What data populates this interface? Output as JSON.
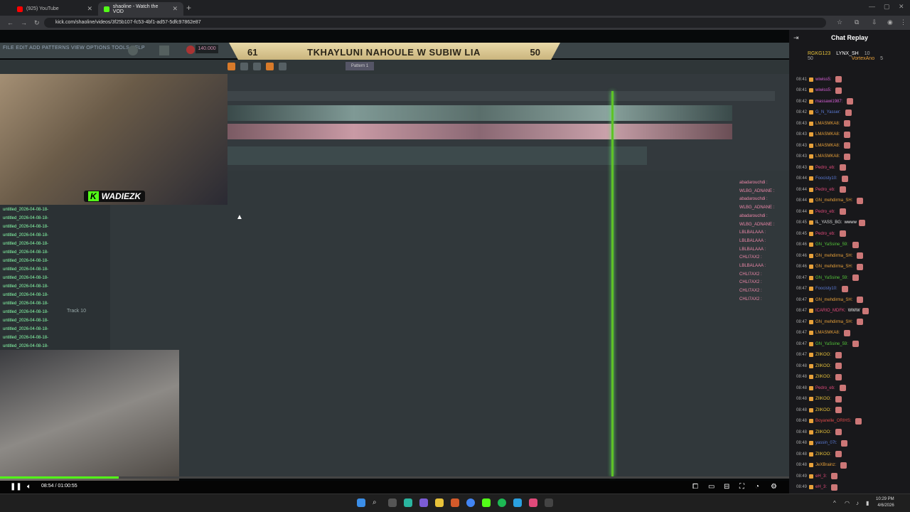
{
  "browser": {
    "tabs": [
      {
        "title": "(925) YouTube",
        "color": "#ff0000"
      },
      {
        "title": "shaoline - Watch the VOD",
        "color": "#53fc18"
      }
    ],
    "url": "kick.com/shaoline/videos/3f25b107-fc53-4bf1-ad57-5dfc97862e87"
  },
  "stream": {
    "menu": "FILE EDIT ADD PATTERNS VIEW OPTIONS TOOLS HELP",
    "tempo": "140.000",
    "pattern": "Pattern 1",
    "banner_left": "61",
    "banner_title": "TKHAYLUNI NAHOULE W SUBIW LIA",
    "banner_right": "50",
    "cam_label": "WADIEZK",
    "track_label": "Track 10",
    "track_clips": [
      "untitled_2026-04-08-18-",
      "untitled_2026-04-08-18-",
      "untitled_2026-04-08-18-",
      "untitled_2026-04-08-18-",
      "untitled_2026-04-08-18-",
      "untitled_2026-04-08-18-",
      "untitled_2026-04-08-18-",
      "untitled_2026-04-08-18-",
      "untitled_2026-04-08-18-",
      "untitled_2026-04-08-18-",
      "untitled_2026-04-08-18-",
      "untitled_2026-04-08-18-",
      "untitled_2026-04-08-18-",
      "untitled_2026-04-08-18-",
      "untitled_2026-04-08-18-",
      "untitled_2026-04-08-18-",
      "untitled_2026-04-08-18-"
    ],
    "overlay_chat": [
      "abadarouchdi :",
      "WLBG_ADNANE :",
      "abadarouchdi :",
      "WLBG_ADNANE :",
      "abadarouchdi :",
      "WLBG_ADNANE :",
      "LBLBALAAA :",
      "LBLBALAAA :",
      "LBLBALAAA :",
      "CHLI7AX2 :",
      "LBLBALAAA :",
      "CHLI7AX2 :",
      "CHLI7AX2 :",
      "CHLI7AX2 :",
      "CHLI7AX2 :"
    ]
  },
  "player": {
    "timecode": "08:54 / 01:00:55",
    "progress": 0.15
  },
  "chat": {
    "title": "Chat Replay",
    "pinned": [
      {
        "name": "RGKG123",
        "count": "50"
      },
      {
        "name": "LYNX_SH",
        "count": "10"
      },
      {
        "name": "VortexAno",
        "count": "5"
      }
    ],
    "messages": [
      {
        "time": "08:41",
        "user": "wiwiss5:",
        "color": "#d45fd4",
        "text": ""
      },
      {
        "time": "08:41",
        "user": "wiwiss5:",
        "color": "#d45fd4",
        "text": ""
      },
      {
        "time": "08:42",
        "user": "massawi1987:",
        "color": "#d45fd4",
        "text": ""
      },
      {
        "time": "08:42",
        "user": "G_N_Yasser:",
        "color": "#5b7bd6",
        "text": ""
      },
      {
        "time": "08:43",
        "user": "LMASMKA8:",
        "color": "#e8a13a",
        "text": ""
      },
      {
        "time": "08:43",
        "user": "LMASMKA8:",
        "color": "#e8a13a",
        "text": ""
      },
      {
        "time": "08:43",
        "user": "LMASMKA8:",
        "color": "#e8a13a",
        "text": ""
      },
      {
        "time": "08:43",
        "user": "LMASMKA8:",
        "color": "#e8a13a",
        "text": ""
      },
      {
        "time": "08:43",
        "user": "Pedro_eb:",
        "color": "#e04a7a",
        "text": ""
      },
      {
        "time": "08:44",
        "user": "Foocisty10:",
        "color": "#5b7bd6",
        "text": ""
      },
      {
        "time": "08:44",
        "user": "Pedro_eb:",
        "color": "#e04a7a",
        "text": ""
      },
      {
        "time": "08:44",
        "user": "GN_mehdirma_SH:",
        "color": "#e8a13a",
        "text": ""
      },
      {
        "time": "08:44",
        "user": "Pedro_eb:",
        "color": "#e04a7a",
        "text": ""
      },
      {
        "time": "08:45",
        "user": "IL_YASS_BG:",
        "color": "#dddddd",
        "text": "wwww"
      },
      {
        "time": "08:45",
        "user": "Pedro_eb:",
        "color": "#e04a7a",
        "text": ""
      },
      {
        "time": "08:46",
        "user": "GN_YaSsine_59:",
        "color": "#53c43a",
        "text": ""
      },
      {
        "time": "08:46",
        "user": "GN_mehdirma_SH:",
        "color": "#e8a13a",
        "text": ""
      },
      {
        "time": "08:46",
        "user": "GN_mehdirma_SH:",
        "color": "#e8a13a",
        "text": ""
      },
      {
        "time": "08:47",
        "user": "GN_YaSsine_59:",
        "color": "#53c43a",
        "text": ""
      },
      {
        "time": "08:47",
        "user": "Foocisty10:",
        "color": "#5b7bd6",
        "text": ""
      },
      {
        "time": "08:47",
        "user": "GN_mehdirma_SH:",
        "color": "#e8a13a",
        "text": ""
      },
      {
        "time": "08:47",
        "user": "ICARIO_MDFK:",
        "color": "#e04a7a",
        "text": "WWW"
      },
      {
        "time": "08:47",
        "user": "GN_mehdirma_SH:",
        "color": "#e8a13a",
        "text": ""
      },
      {
        "time": "08:47",
        "user": "LMASMKA8:",
        "color": "#e8a13a",
        "text": ""
      },
      {
        "time": "08:47",
        "user": "GN_YaSsine_59:",
        "color": "#53c43a",
        "text": ""
      },
      {
        "time": "08:47",
        "user": "ZIIKOO:",
        "color": "#e8c23a",
        "text": ""
      },
      {
        "time": "08:48",
        "user": "ZIIKOO:",
        "color": "#e8c23a",
        "text": ""
      },
      {
        "time": "08:48",
        "user": "ZIIKOO:",
        "color": "#e8c23a",
        "text": ""
      },
      {
        "time": "08:48",
        "user": "Pedro_eb:",
        "color": "#e04a7a",
        "text": ""
      },
      {
        "time": "08:48",
        "user": "ZIIKOO:",
        "color": "#e8c23a",
        "text": ""
      },
      {
        "time": "08:48",
        "user": "ZIIKOO:",
        "color": "#e8c23a",
        "text": ""
      },
      {
        "time": "08:48",
        "user": "Boyanelle_ORIHS:",
        "color": "#e04a4a",
        "text": ""
      },
      {
        "time": "08:48",
        "user": "ZIIKOO:",
        "color": "#e8c23a",
        "text": ""
      },
      {
        "time": "08:48",
        "user": "yassin_07t:",
        "color": "#5b7bd6",
        "text": ""
      },
      {
        "time": "08:48",
        "user": "ZIIKOO:",
        "color": "#e8c23a",
        "text": ""
      },
      {
        "time": "08:48",
        "user": "JeXBrainz:",
        "color": "#e8a13a",
        "text": ""
      },
      {
        "time": "08:49",
        "user": "eH_3:",
        "color": "#e04a7a",
        "text": ""
      },
      {
        "time": "08:49",
        "user": "eH_3:",
        "color": "#e04a7a",
        "text": ""
      }
    ]
  },
  "taskbar": {
    "time": "10:29 PM",
    "date": "4/6/2026"
  }
}
